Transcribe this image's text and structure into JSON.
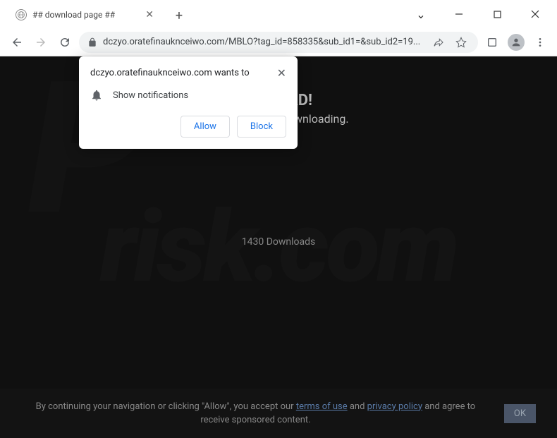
{
  "window": {
    "tab_title": "## download page ##",
    "url": "dczyo.oratefinauknceiwo.com/MBLO?tag_id=858335&sub_id1=&sub_id2=19..."
  },
  "notification_prompt": {
    "origin": "dczyo.oratefinauknceiwo.com wants to",
    "permission_label": "Show notifications",
    "allow_label": "Allow",
    "block_label": "Block"
  },
  "page": {
    "headline": "WNLOAD!",
    "subline": "ations to start downloading.",
    "downloads": "1430 Downloads"
  },
  "cookie_bar": {
    "text_prefix": "By continuing your navigation or clicking \"Allow\", you accept our ",
    "terms_link": "terms of use",
    "text_mid": " and ",
    "privacy_link": "privacy policy",
    "text_suffix": " and agree to receive sponsored content.",
    "ok_label": "OK"
  }
}
